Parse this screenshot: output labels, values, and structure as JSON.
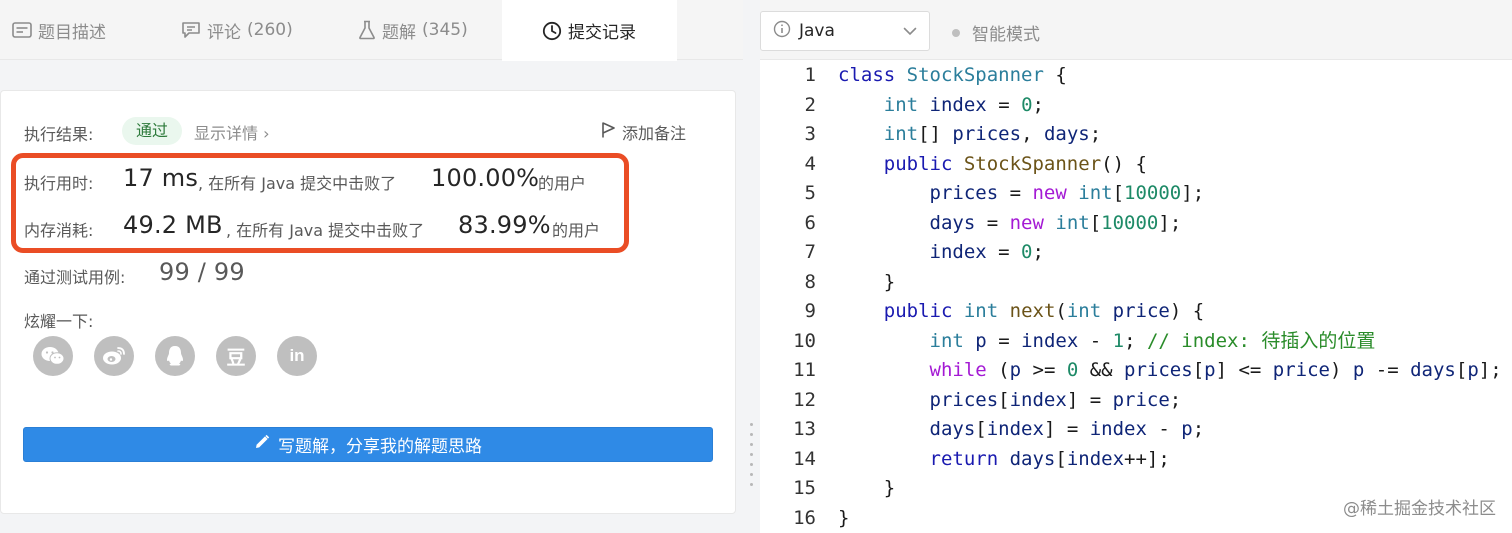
{
  "tabs": [
    {
      "label": "题目描述",
      "count": ""
    },
    {
      "label": "评论",
      "count": "(260)"
    },
    {
      "label": "题解",
      "count": "(345)"
    },
    {
      "label": "提交记录",
      "count": ""
    }
  ],
  "result": {
    "label": "执行结果:",
    "status": "通过",
    "details": "显示详情 ›",
    "add_note": "添加备注"
  },
  "runtime": {
    "label": "执行用时:",
    "value": "17 ms",
    "middle": ", 在所有 Java 提交中击败了",
    "percent": "100.00%",
    "suffix": "的用户"
  },
  "memory": {
    "label": "内存消耗:",
    "value": "49.2 MB",
    "middle": ", 在所有 Java 提交中击败了",
    "percent": "83.99%",
    "suffix": "的用户"
  },
  "tests": {
    "label": "通过测试用例:",
    "value": "99 / 99"
  },
  "share": {
    "label": "炫耀一下:",
    "icons": [
      "wechat-icon",
      "weibo-icon",
      "qq-icon",
      "douban-icon",
      "linkedin-icon"
    ],
    "douban_glyph": "豆",
    "linkedin_glyph": "in"
  },
  "write_button": "写题解，分享我的解题思路",
  "editor": {
    "language": "Java",
    "mode": "智能模式",
    "code_lines": [
      "class StockSpanner {",
      "    int index = 0;",
      "    int[] prices, days;",
      "    public StockSpanner() {",
      "        prices = new int[10000];",
      "        days = new int[10000];",
      "        index = 0;",
      "    }",
      "    public int next(int price) {",
      "        int p = index - 1; // index: 待插入的位置",
      "        while (p >= 0 && prices[p] <= price) p -= days[p];",
      "        prices[index] = price;",
      "        days[index] = index - p;",
      "        return days[index++];",
      "    }",
      "}"
    ]
  },
  "watermark": "@稀土掘金技术社区",
  "colors": {
    "highlight_border": "#ea4d25",
    "pass_badge_bg": "#eaf7ee",
    "button_blue": "#2f8ae6"
  }
}
